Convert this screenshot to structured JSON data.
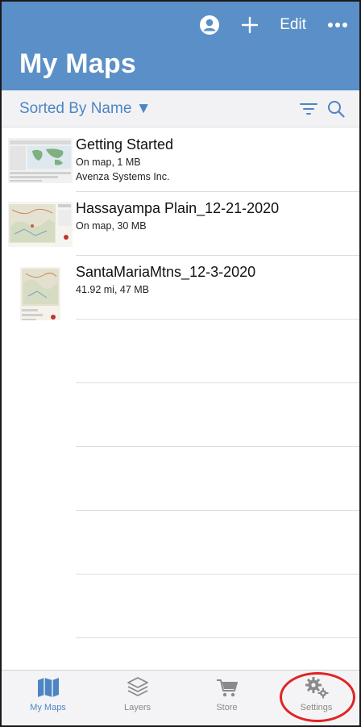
{
  "header": {
    "title": "My Maps",
    "edit_label": "Edit",
    "icons": [
      "account-icon",
      "add-icon",
      "more-icon"
    ]
  },
  "sortbar": {
    "label": "Sorted By Name",
    "icons": [
      "filter-icon",
      "search-icon"
    ]
  },
  "maps": [
    {
      "name": "Getting Started",
      "line1": "On map, 1 MB",
      "line2": "Avenza Systems Inc."
    },
    {
      "name": "Hassayampa Plain_12-21-2020",
      "line1": "On map, 30 MB",
      "line2": ""
    },
    {
      "name": "SantaMariaMtns_12-3-2020",
      "line1": "41.92 mi, 47 MB",
      "line2": ""
    }
  ],
  "tabs": [
    {
      "label": "My Maps",
      "icon": "map-icon",
      "active": true
    },
    {
      "label": "Layers",
      "icon": "layers-icon",
      "active": false
    },
    {
      "label": "Store",
      "icon": "cart-icon",
      "active": false
    },
    {
      "label": "Settings",
      "icon": "gears-icon",
      "active": false
    }
  ],
  "colors": {
    "header": "#5b8fc7",
    "accent": "#4d85c3",
    "annotation": "#e02424"
  }
}
